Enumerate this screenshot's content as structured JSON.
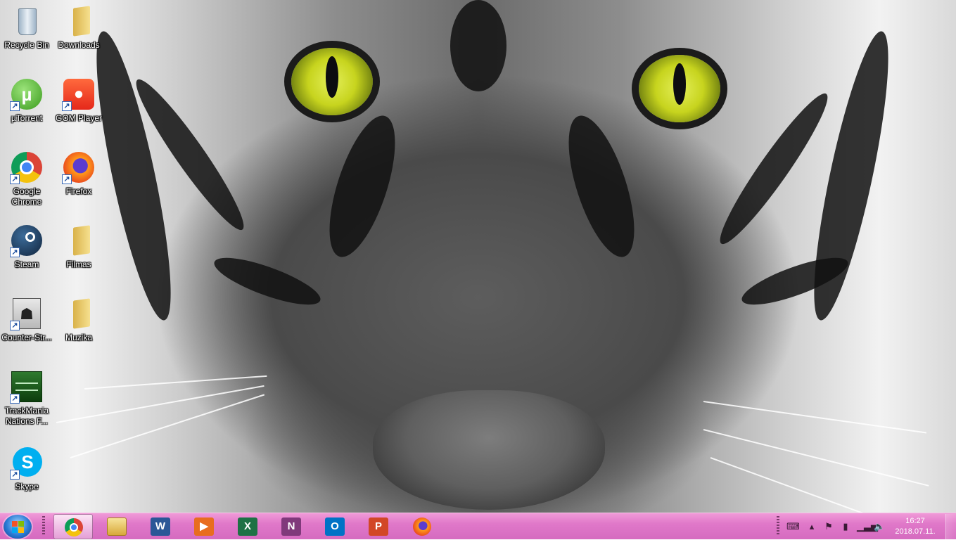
{
  "desktop": {
    "icons": [
      {
        "label": "Recycle Bin",
        "icon": "recycle-bin-icon",
        "shortcut": false
      },
      {
        "label": "Downloads",
        "icon": "folder-icon",
        "shortcut": false
      },
      {
        "label": "µTorrent",
        "icon": "utorrent-icon",
        "shortcut": true
      },
      {
        "label": "GOM Player",
        "icon": "gom-player-icon",
        "shortcut": true
      },
      {
        "label": "Google\nChrome",
        "icon": "chrome-icon",
        "shortcut": true
      },
      {
        "label": "Firefox",
        "icon": "firefox-icon",
        "shortcut": true
      },
      {
        "label": "Steam",
        "icon": "steam-icon",
        "shortcut": true
      },
      {
        "label": "Filmas",
        "icon": "folder-icon",
        "shortcut": false
      },
      {
        "label": "Counter-Str...",
        "icon": "counter-strike-icon",
        "shortcut": true
      },
      {
        "label": "Muzika",
        "icon": "folder-icon",
        "shortcut": false
      },
      {
        "label": "TrackMania\nNations F...",
        "icon": "trackmania-icon",
        "shortcut": true
      },
      {
        "label": "Skype",
        "icon": "skype-icon",
        "shortcut": true
      }
    ]
  },
  "taskbar": {
    "start_icon": "windows-start-icon",
    "pinned": [
      {
        "app": "Google Chrome",
        "icon": "chrome-icon",
        "active": true,
        "glyph": "",
        "color": "#ffffff"
      },
      {
        "app": "File Explorer",
        "icon": "folder-icon",
        "active": false,
        "glyph": "",
        "color": "#e8c35a"
      },
      {
        "app": "Word",
        "icon": "word-icon",
        "active": false,
        "glyph": "W",
        "color": "#2b5797"
      },
      {
        "app": "Media Player",
        "icon": "media-player-icon",
        "active": false,
        "glyph": "▶",
        "color": "#e86d1f"
      },
      {
        "app": "Excel",
        "icon": "excel-icon",
        "active": false,
        "glyph": "X",
        "color": "#1e7145"
      },
      {
        "app": "OneNote",
        "icon": "onenote-icon",
        "active": false,
        "glyph": "N",
        "color": "#80397b"
      },
      {
        "app": "Outlook",
        "icon": "outlook-icon",
        "active": false,
        "glyph": "O",
        "color": "#0072c6"
      },
      {
        "app": "PowerPoint",
        "icon": "powerpoint-icon",
        "active": false,
        "glyph": "P",
        "color": "#d24726"
      },
      {
        "app": "Firefox",
        "icon": "firefox-icon",
        "active": false,
        "glyph": "",
        "color": "#ff7a1a"
      }
    ],
    "tray": {
      "icons": [
        "keyboard-icon",
        "chevron-up-icon",
        "action-center-flag-icon",
        "power-icon",
        "network-signal-icon",
        "volume-icon"
      ],
      "time": "16:27",
      "date": "2018.07.11."
    }
  }
}
